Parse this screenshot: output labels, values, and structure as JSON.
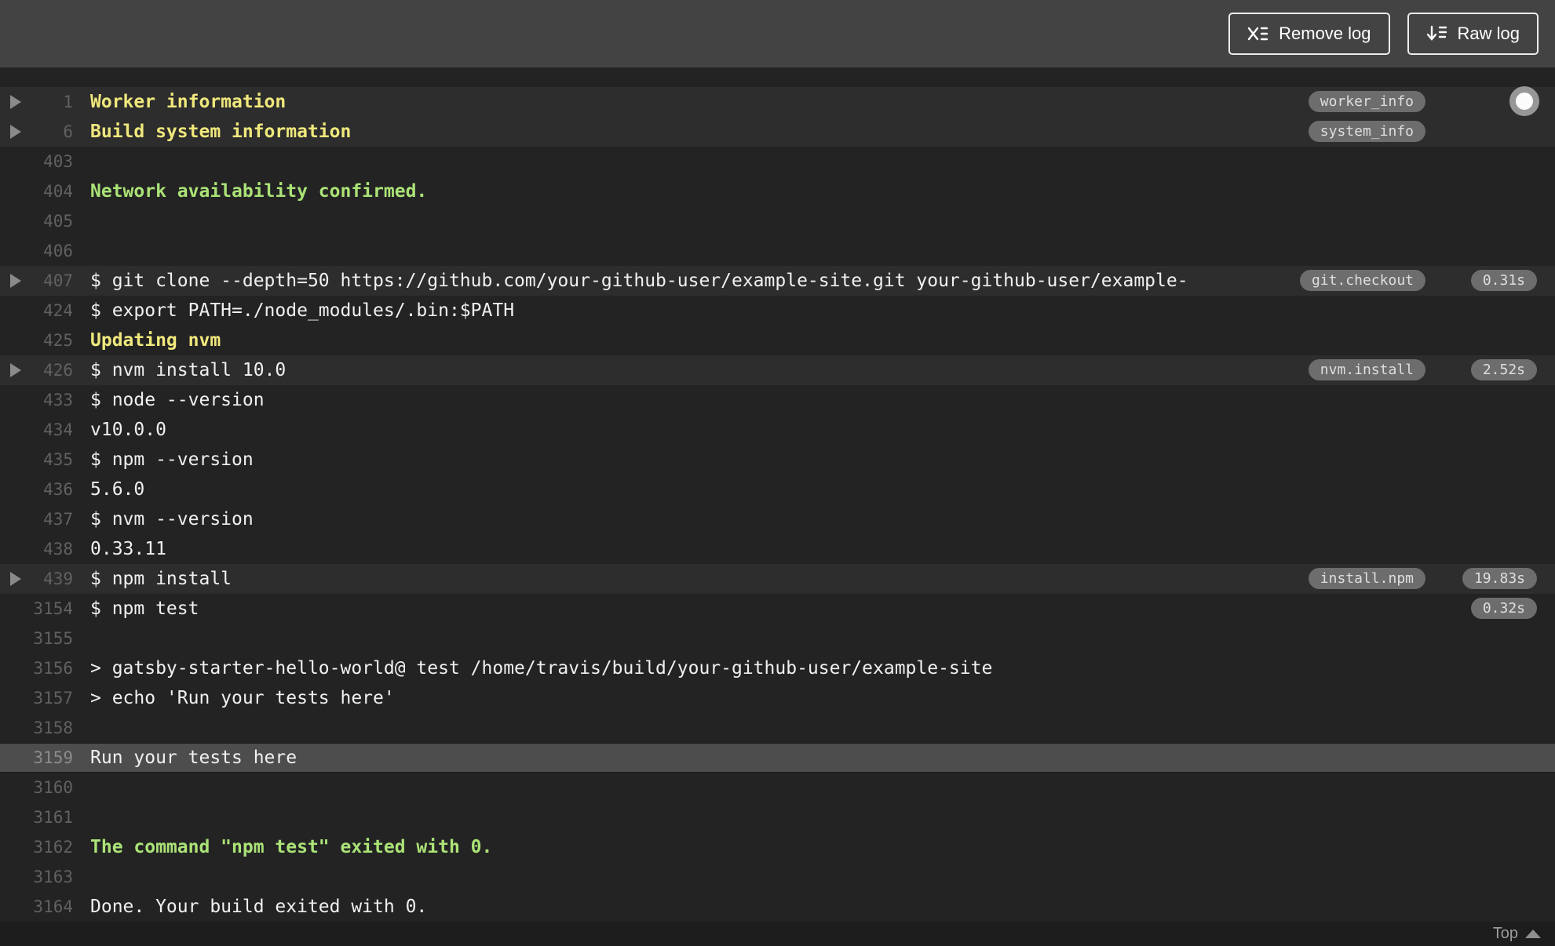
{
  "header": {
    "remove_log_label": "Remove log",
    "raw_log_label": "Raw log"
  },
  "footer": {
    "top_label": "Top"
  },
  "colors": {
    "header_bg": "#434343",
    "log_bg": "#232323",
    "fold_row_bg": "#2d2d2d",
    "highlight_row_bg": "#4d4d4d",
    "fold_title_yellow": "#f0e87c",
    "success_green": "#abe377",
    "badge_bg": "#6d6d6d",
    "line_number_gray": "#616161"
  },
  "icons": {
    "remove_log": "x-with-lines-icon",
    "raw_log": "download-lines-icon",
    "fold_arrow": "chevron-right-icon",
    "top": "caret-up-icon",
    "scroll": "scroll-dot-indicator"
  },
  "log": {
    "rows": [
      {
        "num": "1",
        "text": "Worker information",
        "style": "yellow",
        "fold": true,
        "badge": "worker_info"
      },
      {
        "num": "6",
        "text": "Build system information",
        "style": "yellow",
        "fold": true,
        "badge": "system_info"
      },
      {
        "num": "403",
        "text": ""
      },
      {
        "num": "404",
        "text": "Network availability confirmed.",
        "style": "green"
      },
      {
        "num": "405",
        "text": ""
      },
      {
        "num": "406",
        "text": ""
      },
      {
        "num": "407",
        "text": "$ git clone --depth=50 https://github.com/your-github-user/example-site.git your-github-user/example-",
        "fold": true,
        "badge": "git.checkout",
        "time": "0.31s"
      },
      {
        "num": "424",
        "text": "$ export PATH=./node_modules/.bin:$PATH"
      },
      {
        "num": "425",
        "text": "Updating nvm",
        "style": "yellow"
      },
      {
        "num": "426",
        "text": "$ nvm install 10.0",
        "fold": true,
        "badge": "nvm.install",
        "time": "2.52s"
      },
      {
        "num": "433",
        "text": "$ node --version"
      },
      {
        "num": "434",
        "text": "v10.0.0"
      },
      {
        "num": "435",
        "text": "$ npm --version"
      },
      {
        "num": "436",
        "text": "5.6.0"
      },
      {
        "num": "437",
        "text": "$ nvm --version"
      },
      {
        "num": "438",
        "text": "0.33.11"
      },
      {
        "num": "439",
        "text": "$ npm install",
        "fold": true,
        "badge": "install.npm",
        "time": "19.83s"
      },
      {
        "num": "3154",
        "text": "$ npm test",
        "time": "0.32s"
      },
      {
        "num": "3155",
        "text": ""
      },
      {
        "num": "3156",
        "text": "> gatsby-starter-hello-world@ test /home/travis/build/your-github-user/example-site"
      },
      {
        "num": "3157",
        "text": "> echo 'Run your tests here'"
      },
      {
        "num": "3158",
        "text": ""
      },
      {
        "num": "3159",
        "text": "Run your tests here",
        "highlight": true
      },
      {
        "num": "3160",
        "text": ""
      },
      {
        "num": "3161",
        "text": ""
      },
      {
        "num": "3162",
        "text": "The command \"npm test\" exited with 0.",
        "style": "green"
      },
      {
        "num": "3163",
        "text": ""
      },
      {
        "num": "3164",
        "text": "Done. Your build exited with 0."
      }
    ]
  }
}
